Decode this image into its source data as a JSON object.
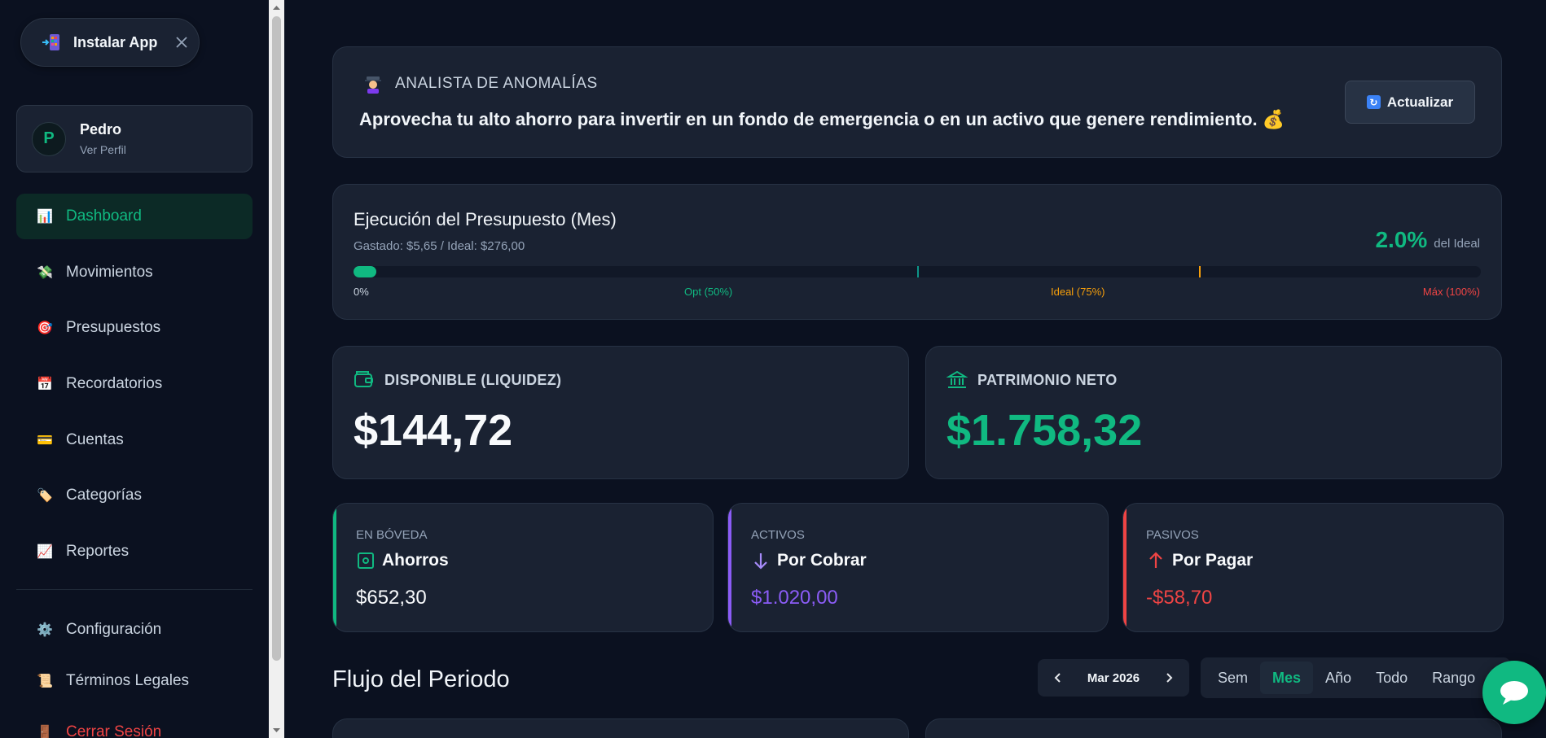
{
  "install": {
    "label": "Instalar App"
  },
  "profile": {
    "initial": "P",
    "name": "Pedro",
    "sub": "Ver Perfil"
  },
  "nav": [
    {
      "label": "Dashboard",
      "emoji": "📊"
    },
    {
      "label": "Movimientos",
      "emoji": "💸"
    },
    {
      "label": "Presupuestos",
      "emoji": "🎯"
    },
    {
      "label": "Recordatorios",
      "emoji": "📅"
    },
    {
      "label": "Cuentas",
      "emoji": "💳"
    },
    {
      "label": "Categorías",
      "emoji": "🏷️"
    },
    {
      "label": "Reportes",
      "emoji": "📈"
    },
    {
      "label": "Configuración",
      "emoji": "⚙️"
    },
    {
      "label": "Términos Legales",
      "emoji": "📜"
    },
    {
      "label": "Cerrar Sesión",
      "emoji": "🚪"
    }
  ],
  "anomaly": {
    "title": "ANALISTA DE ANOMALÍAS",
    "message": "Aprovecha tu alto ahorro para invertir en un fondo de emergencia o en un activo que genere rendimiento. 💰",
    "button": "Actualizar"
  },
  "budget": {
    "title": "Ejecución del Presupuesto (Mes)",
    "subtitle": "Gastado: $5,65 / Ideal: $276,00",
    "percent": "2.0%",
    "percent_suffix": "del Ideal",
    "progress_fraction": 0.02,
    "scale": {
      "zero": "0%",
      "opt": "Opt (50%)",
      "ideal": "Ideal (75%)",
      "max": "Máx (100%)"
    }
  },
  "cards": {
    "available": {
      "label": "DISPONIBLE (LIQUIDEZ)",
      "value": "$144,72"
    },
    "networth": {
      "label": "PATRIMONIO NETO",
      "value": "$1.758,32"
    }
  },
  "small": {
    "vault": {
      "kicker": "EN BÓVEDA",
      "title": "Ahorros",
      "value": "$652,30"
    },
    "assets": {
      "kicker": "ACTIVOS",
      "title": "Por Cobrar",
      "value": "$1.020,00"
    },
    "liabilities": {
      "kicker": "PASIVOS",
      "title": "Por Pagar",
      "value": "-$58,70"
    }
  },
  "flow": {
    "title": "Flujo del Periodo",
    "period": "Mar 2026",
    "ranges": [
      "Sem",
      "Mes",
      "Año",
      "Todo",
      "Rango"
    ],
    "active_range": "Mes"
  },
  "colors": {
    "accent": "#10b981",
    "purple": "#8b5cf6",
    "red": "#ef4444",
    "orange": "#f59e0b",
    "bg": "#0b1120",
    "card": "#1a2232"
  }
}
